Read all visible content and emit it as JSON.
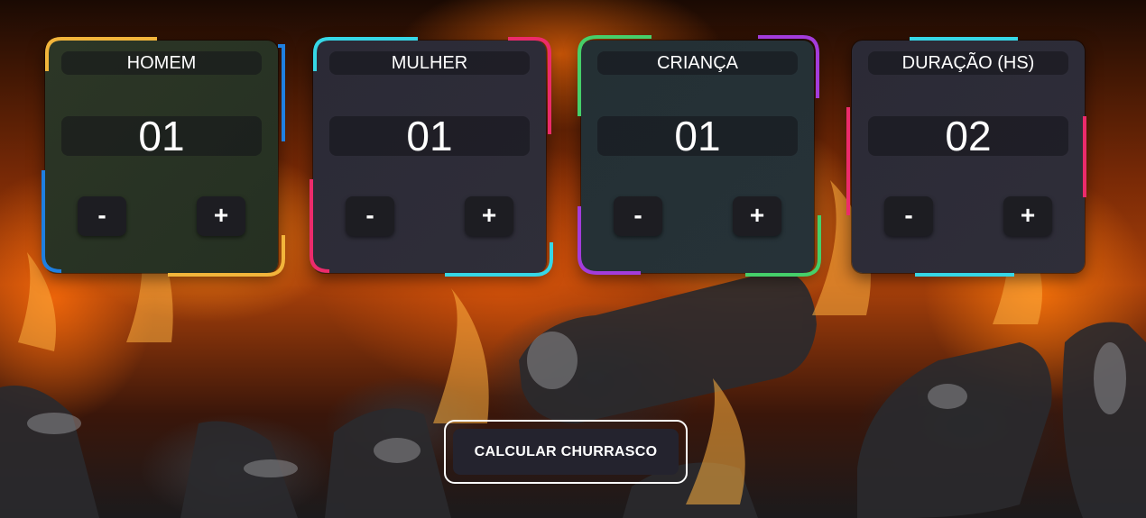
{
  "cards": [
    {
      "title": "HOMEM",
      "value": "01",
      "minus": "-",
      "plus": "+"
    },
    {
      "title": "MULHER",
      "value": "01",
      "minus": "-",
      "plus": "+"
    },
    {
      "title": "CRIANÇA",
      "value": "01",
      "minus": "-",
      "plus": "+"
    },
    {
      "title": "DURAÇÃO (HS)",
      "value": "02",
      "minus": "-",
      "plus": "+"
    }
  ],
  "calculate_button": "CALCULAR CHURRASCO",
  "colors": {
    "yellow": "#f2b53b",
    "blue": "#1f7fe0",
    "pink": "#ec2b6b",
    "cyan": "#36d7e6",
    "green": "#45d06a",
    "purple": "#a33cdc"
  }
}
